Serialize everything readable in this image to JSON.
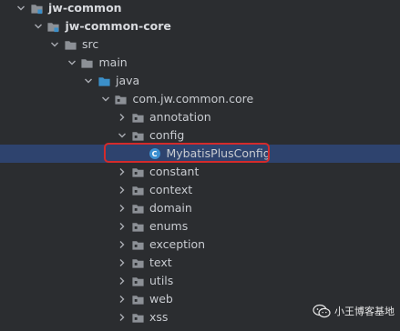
{
  "tree": {
    "rows": [
      {
        "label": "jw-common",
        "indent": 0,
        "state": "open",
        "icon": "module-folder-icon",
        "bold": true
      },
      {
        "label": "jw-common-core",
        "indent": 1,
        "state": "open",
        "icon": "module-folder-icon",
        "bold": true
      },
      {
        "label": "src",
        "indent": 2,
        "state": "open",
        "icon": "folder-icon",
        "bold": false
      },
      {
        "label": "main",
        "indent": 3,
        "state": "open",
        "icon": "folder-icon",
        "bold": false
      },
      {
        "label": "java",
        "indent": 4,
        "state": "open",
        "icon": "source-folder-icon",
        "bold": false
      },
      {
        "label": "com.jw.common.core",
        "indent": 5,
        "state": "open",
        "icon": "package-icon",
        "bold": false
      },
      {
        "label": "annotation",
        "indent": 6,
        "state": "closed",
        "icon": "package-icon",
        "bold": false
      },
      {
        "label": "config",
        "indent": 6,
        "state": "open",
        "icon": "package-icon",
        "bold": false
      },
      {
        "label": "MybatisPlusConfig",
        "indent": 7,
        "state": "leaf",
        "icon": "java-class-icon",
        "bold": false,
        "selected": true
      },
      {
        "label": "constant",
        "indent": 6,
        "state": "closed",
        "icon": "package-icon",
        "bold": false
      },
      {
        "label": "context",
        "indent": 6,
        "state": "closed",
        "icon": "package-icon",
        "bold": false
      },
      {
        "label": "domain",
        "indent": 6,
        "state": "closed",
        "icon": "package-icon",
        "bold": false
      },
      {
        "label": "enums",
        "indent": 6,
        "state": "closed",
        "icon": "package-icon",
        "bold": false
      },
      {
        "label": "exception",
        "indent": 6,
        "state": "closed",
        "icon": "package-icon",
        "bold": false
      },
      {
        "label": "text",
        "indent": 6,
        "state": "closed",
        "icon": "package-icon",
        "bold": false
      },
      {
        "label": "utils",
        "indent": 6,
        "state": "closed",
        "icon": "package-icon",
        "bold": false
      },
      {
        "label": "web",
        "indent": 6,
        "state": "closed",
        "icon": "package-icon",
        "bold": false
      },
      {
        "label": "xss",
        "indent": 6,
        "state": "closed",
        "icon": "package-icon",
        "bold": false
      }
    ],
    "class_icon_letter": "C"
  },
  "watermark": {
    "text": "小王博客基地",
    "icon": "wechat-icon"
  },
  "colors": {
    "background": "#2b2d30",
    "selection": "#2e436e",
    "highlight_border": "#d42b2b",
    "folder": "#8c9096",
    "source_folder": "#3b8fc9",
    "class_icon": "#3c8fd0"
  }
}
